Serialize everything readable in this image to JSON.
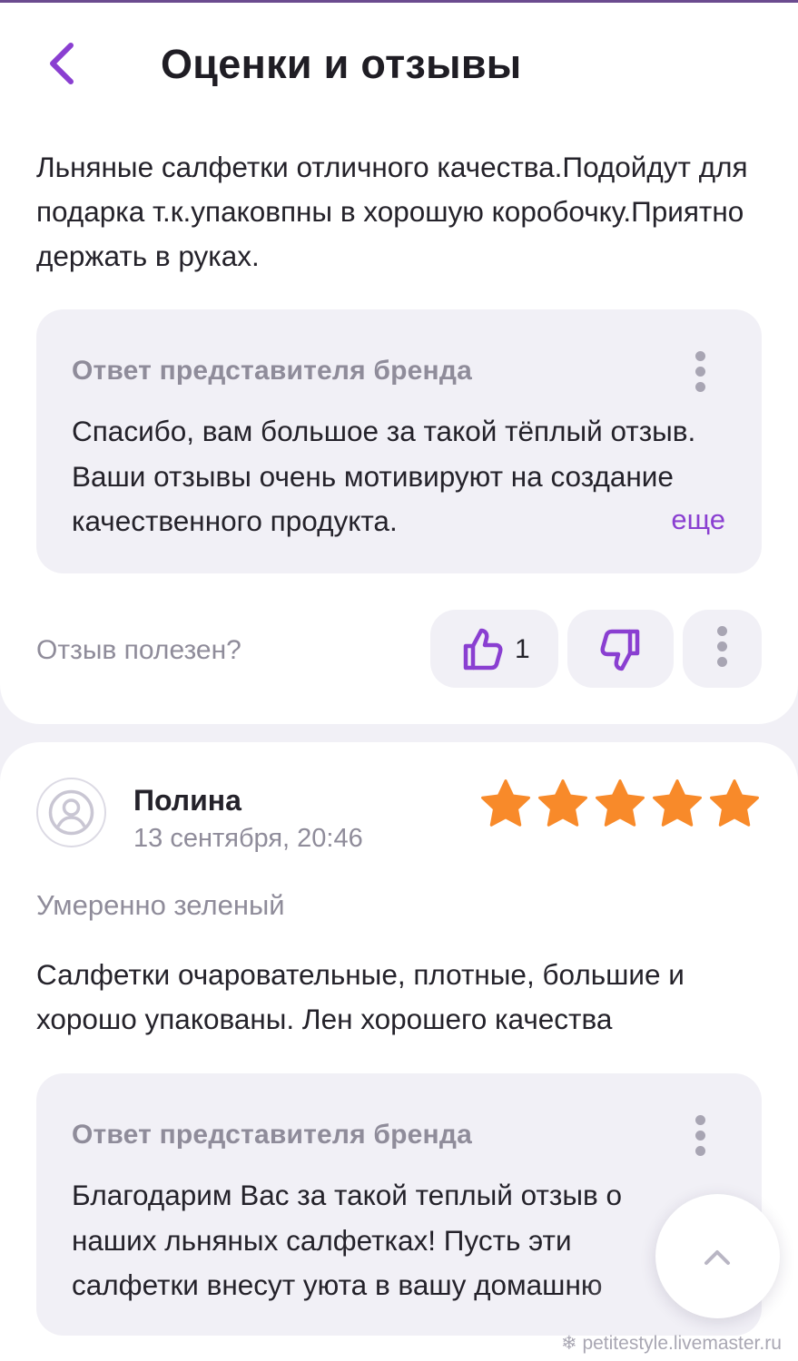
{
  "header": {
    "title": "Оценки и отзывы"
  },
  "review1": {
    "text": "Льняные салфетки отличного качества.Подойдут для подарка т.к.упаковпны в хорошую коробочку.Приятно держать в руках.",
    "reply": {
      "title": "Ответ представителя бренда",
      "text": "Спасибо, вам большое за такой тёплый отзыв. Ваши отзывы очень мотивируют на создание качественного продукта.",
      "more_label": "еще"
    },
    "helpful": {
      "label": "Отзыв полезен?",
      "likes": "1"
    }
  },
  "review2": {
    "author": "Полина",
    "date": "13 сентября, 20:46",
    "rating": 5,
    "variant": "Умеренно зеленый",
    "text": "Салфетки очаровательные, плотные, большие и хорошо упакованы. Лен хорошего качества",
    "reply": {
      "title": "Ответ представителя бренда",
      "text": "Благодарим Вас за такой теплый отзыв о наших льняных салфетках! Пусть эти салфетки внесут уюта в вашу домашню"
    }
  },
  "watermark": "petitestyle.livemaster.ru",
  "colors": {
    "accent": "#8a3fd1",
    "star": "#f88a2a",
    "background": "#f1f0f6"
  },
  "icons": {
    "back": "chevron-left-icon",
    "like": "thumbs-up-icon",
    "dislike": "thumbs-down-icon",
    "more": "kebab-icon",
    "avatar": "user-icon",
    "scroll_top": "chevron-up-icon"
  }
}
